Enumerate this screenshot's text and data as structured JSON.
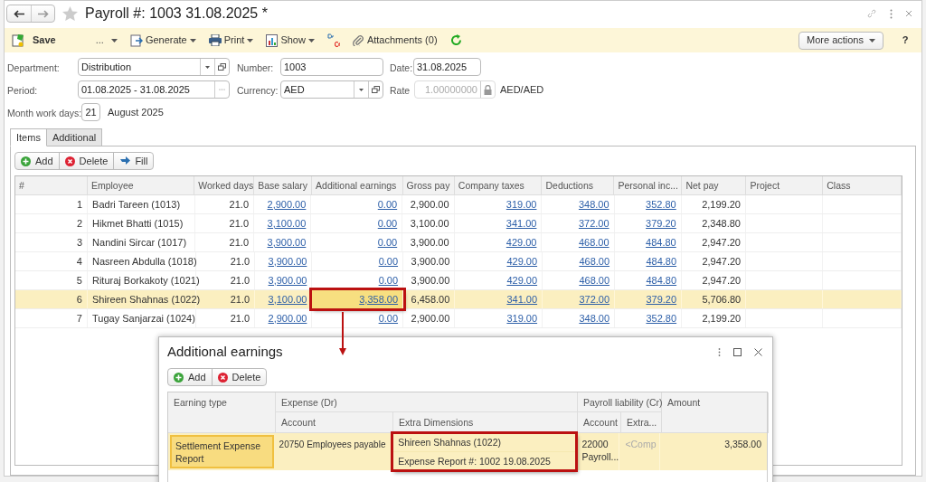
{
  "window": {
    "title": "Payroll #: 1003 31.08.2025 *",
    "favorite": false
  },
  "toolbar": {
    "save": "Save",
    "more": "...",
    "items": [
      {
        "label": "Generate",
        "kind": "menu"
      },
      {
        "label": "Print",
        "kind": "menu"
      },
      {
        "label": "Show",
        "kind": "menu"
      },
      {
        "kind": "icon"
      },
      {
        "label": "Attachments (0)",
        "kind": "plain"
      },
      {
        "kind": "icon"
      }
    ],
    "more_actions": "More actions",
    "help": "?"
  },
  "fields": {
    "department": {
      "label": "Department:",
      "value": "Distribution"
    },
    "number": {
      "label": "Number:",
      "value": "1003"
    },
    "date": {
      "label": "Date:",
      "value": "31.08.2025"
    },
    "period": {
      "label": "Period:",
      "value": "01.08.2025 - 31.08.2025"
    },
    "currency": {
      "label": "Currency:",
      "value": "AED"
    },
    "rate": {
      "label": "Rate",
      "value": "1.00000000",
      "disabled": true,
      "unit": "AED/AED"
    },
    "work_days": {
      "label": "Month work days:",
      "value": "21",
      "month": "August 2025"
    }
  },
  "tabs": [
    {
      "label": "Items",
      "selected": true
    },
    {
      "label": "Additional",
      "selected": false
    }
  ],
  "table_buttons": [
    "Add",
    "Delete",
    "Fill"
  ],
  "table": {
    "columns": [
      {
        "label": "#",
        "kind": "number"
      },
      {
        "label": "Employee",
        "kind": "text"
      },
      {
        "label": "Worked days",
        "kind": "number"
      },
      {
        "label": "Base salary",
        "kind": "link"
      },
      {
        "label": "Additional earnings",
        "kind": "link"
      },
      {
        "label": "Gross pay",
        "kind": "number"
      },
      {
        "label": "Company taxes",
        "kind": "link"
      },
      {
        "label": "Deductions",
        "kind": "link"
      },
      {
        "label": "Personal inc...",
        "kind": "link"
      },
      {
        "label": "Net pay",
        "kind": "number"
      },
      {
        "label": "Project"
      },
      {
        "label": "Class"
      }
    ],
    "rows": [
      {
        "selected": false,
        "callout": false,
        "cells": [
          "1",
          "Badri Tareen (1013)",
          "21.0",
          "2,900.00",
          "0.00",
          "2,900.00",
          "319.00",
          "348.00",
          "352.80",
          "2,199.20"
        ]
      },
      {
        "selected": false,
        "callout": false,
        "cells": [
          "2",
          "Hikmet Bhatti (1015)",
          "21.0",
          "3,100.00",
          "0.00",
          "3,100.00",
          "341.00",
          "372.00",
          "379.20",
          "2,348.80"
        ]
      },
      {
        "selected": false,
        "callout": false,
        "cells": [
          "3",
          "Nandini Sircar (1017)",
          "21.0",
          "3,900.00",
          "0.00",
          "3,900.00",
          "429.00",
          "468.00",
          "484.80",
          "2,947.20"
        ]
      },
      {
        "selected": false,
        "callout": false,
        "cells": [
          "4",
          "Nasreen Abdulla (1018)",
          "21.0",
          "3,900.00",
          "0.00",
          "3,900.00",
          "429.00",
          "468.00",
          "484.80",
          "2,947.20"
        ]
      },
      {
        "selected": false,
        "callout": false,
        "cells": [
          "5",
          "Rituraj Borkakoty (1021)",
          "21.0",
          "3,900.00",
          "0.00",
          "3,900.00",
          "429.00",
          "468.00",
          "484.80",
          "2,947.20"
        ]
      },
      {
        "selected": true,
        "callout": true,
        "cells": [
          "6",
          "Shireen Shahnas (1022)",
          "21.0",
          "3,100.00",
          "3,358.00",
          "6,458.00",
          "341.00",
          "372.00",
          "379.20",
          "5,706.80"
        ]
      },
      {
        "selected": false,
        "callout": false,
        "cells": [
          "7",
          "Tugay Sanjarzai (1024)",
          "21.0",
          "2,900.00",
          "0.00",
          "2,900.00",
          "319.00",
          "348.00",
          "352.80",
          "2,199.20"
        ]
      }
    ]
  },
  "popup": {
    "title": "Additional earnings",
    "buttons": [
      "Add",
      "Delete"
    ],
    "groups": [
      "Earning type",
      "Expense (Dr)",
      "Payroll liability (Cr)",
      "Amount"
    ],
    "subheaders": [
      "Account",
      "Extra Dimensions",
      "Account",
      "Extra..."
    ],
    "rows": [
      {
        "selected": true,
        "earning_type": "Settlement Expense Report",
        "expense_account": "20750 Employees payable",
        "extra_dimensions": [
          "Shireen Shahnas (1022)",
          "Expense Report #: 1002 19.08.2025"
        ],
        "dimensions_highlighted": true,
        "liability_account": "22000 Payroll...",
        "liability_extra": "<Comp",
        "amount": "3,358.00"
      }
    ]
  }
}
